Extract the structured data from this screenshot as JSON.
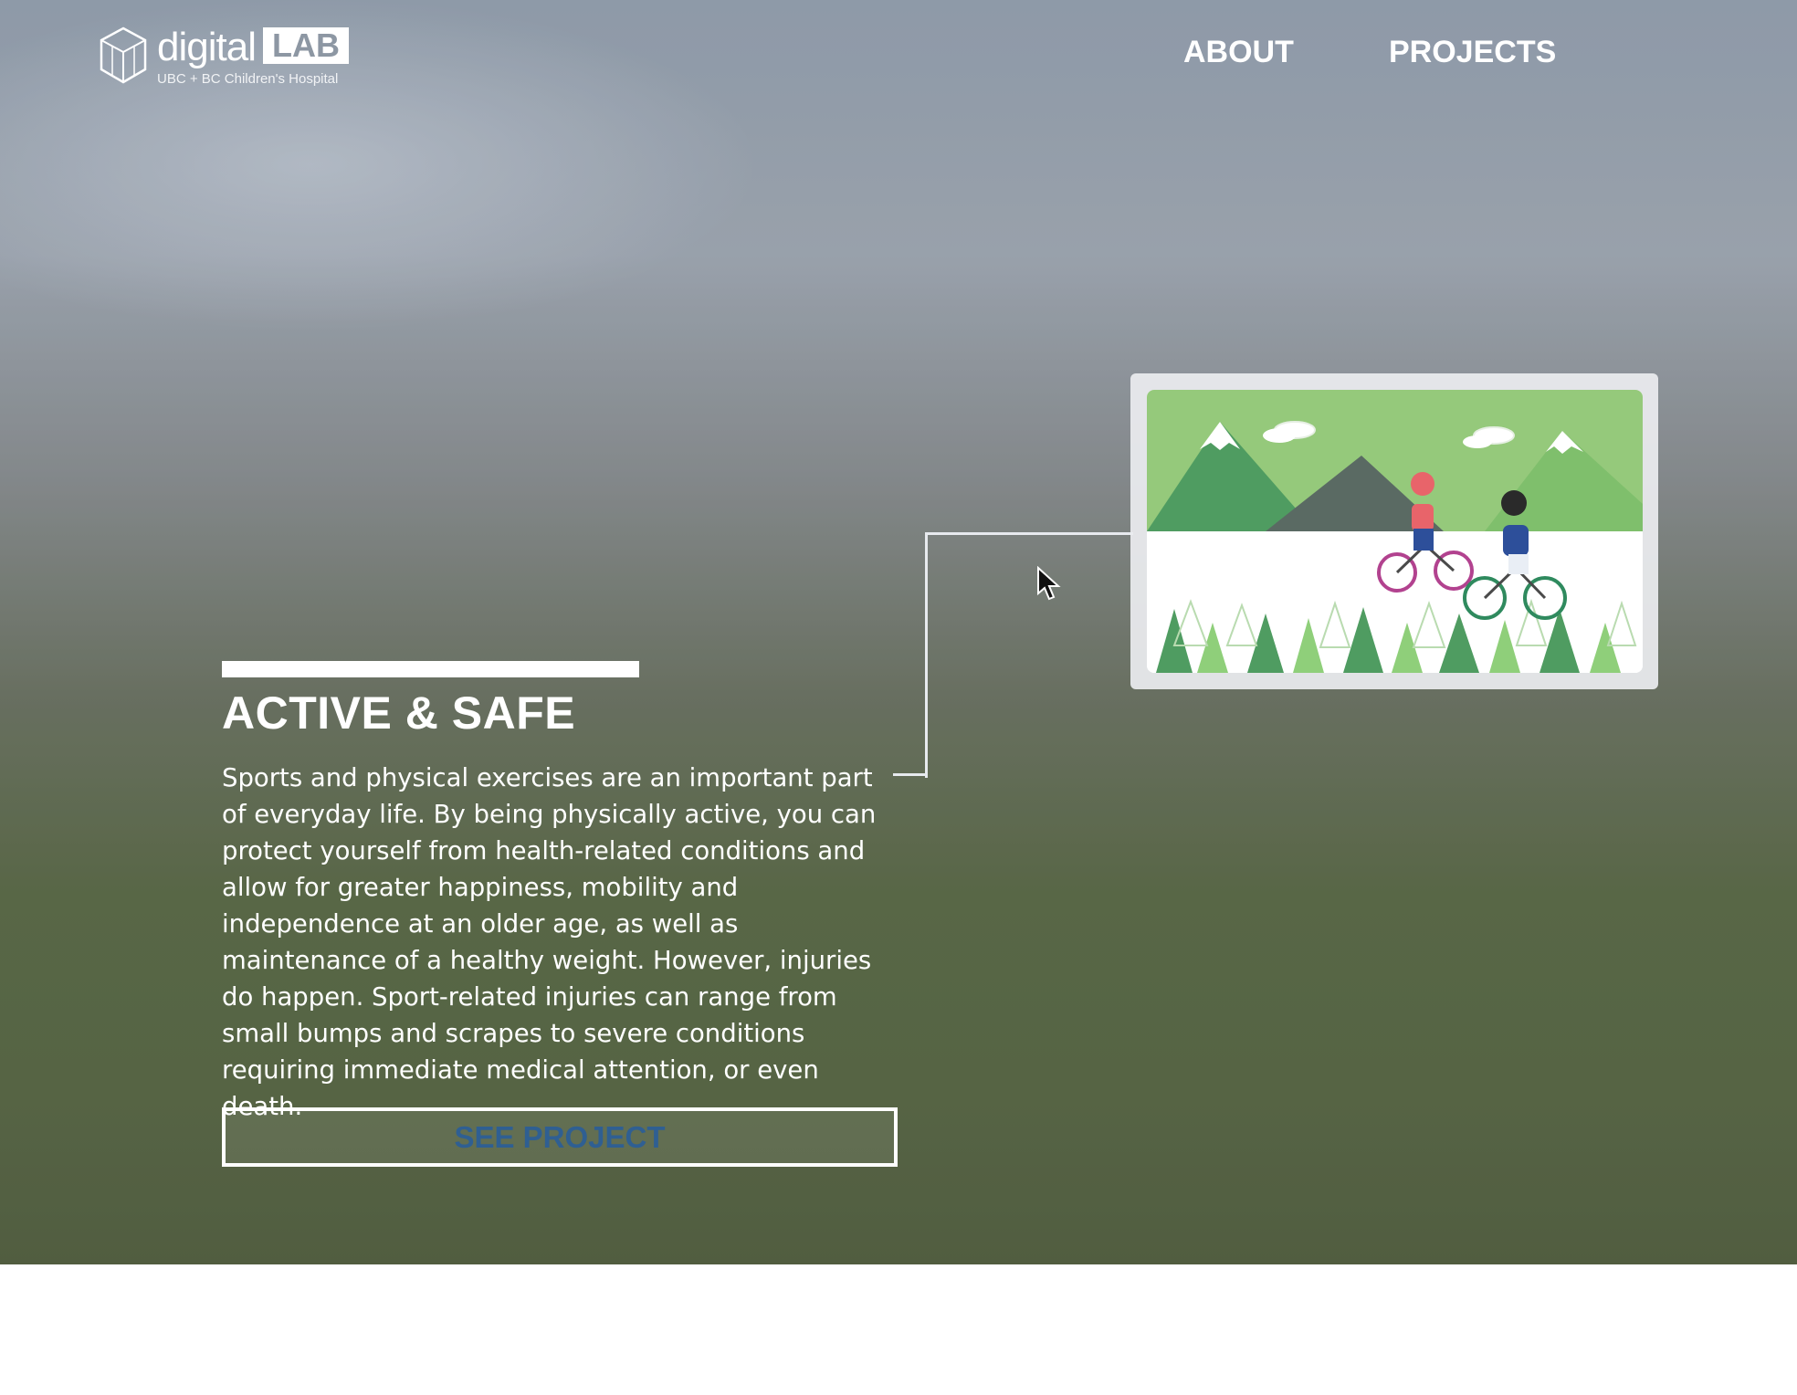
{
  "brand": {
    "name": "digital",
    "badge": "LAB",
    "subtitle": "UBC + BC Children's Hospital",
    "icon": "cube-logo-icon"
  },
  "nav": {
    "items": [
      {
        "label": "ABOUT"
      },
      {
        "label": "PROJECTS"
      }
    ]
  },
  "hero": {
    "title": "ACTIVE & SAFE",
    "body": "Sports and physical exercises are an important part of everyday life. By being physically active, you can protect yourself from health-related conditions and allow for greater happiness, mobility and independence at an older age, as well as maintenance of a healthy weight. However, injuries do happen. Sport-related injuries can range from small bumps and scrapes to severe conditions requiring immediate medical attention, or even death.",
    "cta_label": "SEE PROJECT",
    "illustration": "cyclists-mountains-illustration",
    "cursor": "mouse-pointer-icon"
  },
  "colors": {
    "cta_text": "#2f5f92",
    "illustration_green": "#95c97b",
    "illustration_dark_green": "#4f9c61"
  }
}
